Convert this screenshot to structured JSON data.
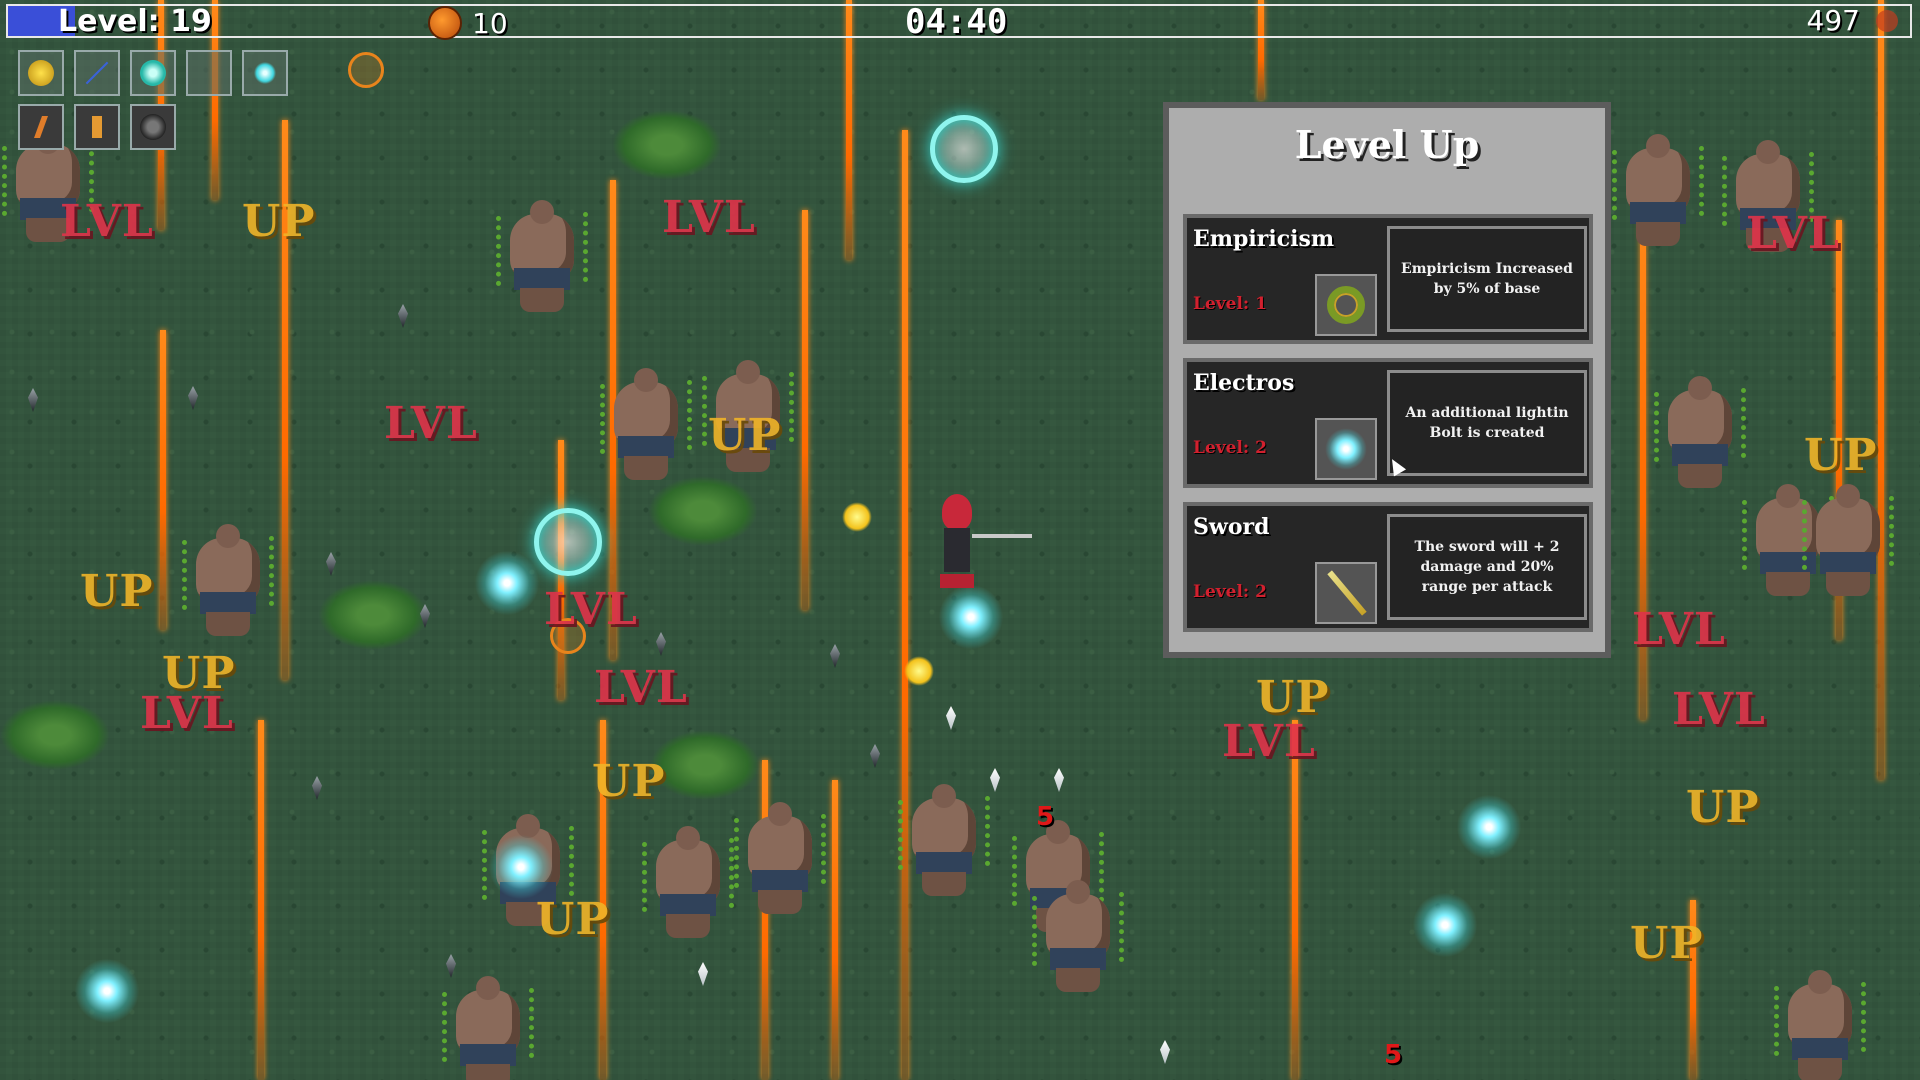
{
  "hud": {
    "level": "Level: 19",
    "gold": "10",
    "timer": "04:40",
    "kills": "497",
    "xp_progress": 0.035
  },
  "inventory": {
    "weapons": [
      "sun-icon",
      "staff-icon",
      "vortex-icon",
      "sword-icon",
      "lightning-icon"
    ],
    "passives": [
      "boots-icon",
      "flag-icon",
      "skull-icon"
    ]
  },
  "level_up": {
    "title": "Level Up",
    "options": [
      {
        "name": "Empiricism",
        "level": "Level: 1",
        "description": "Empiricism Increased by 5% of base",
        "icon": "ring-icon"
      },
      {
        "name": "Electros",
        "level": "Level: 2",
        "description": "An additional lightin Bolt is created",
        "icon": "lightning-icon"
      },
      {
        "name": "Sword",
        "level": "Level: 2",
        "description": "The sword will + 2 damage and 20% range per attack",
        "icon": "sword-icon"
      }
    ]
  },
  "floating_text": {
    "lvl": "LVL",
    "up": "UP",
    "damage": "5"
  },
  "colors": {
    "xp_bar": "#3a4fd8",
    "lvl_text": "#e0334a",
    "up_text": "#f0b428",
    "beam": "#ff6a00",
    "level_label": "#d2202e"
  }
}
